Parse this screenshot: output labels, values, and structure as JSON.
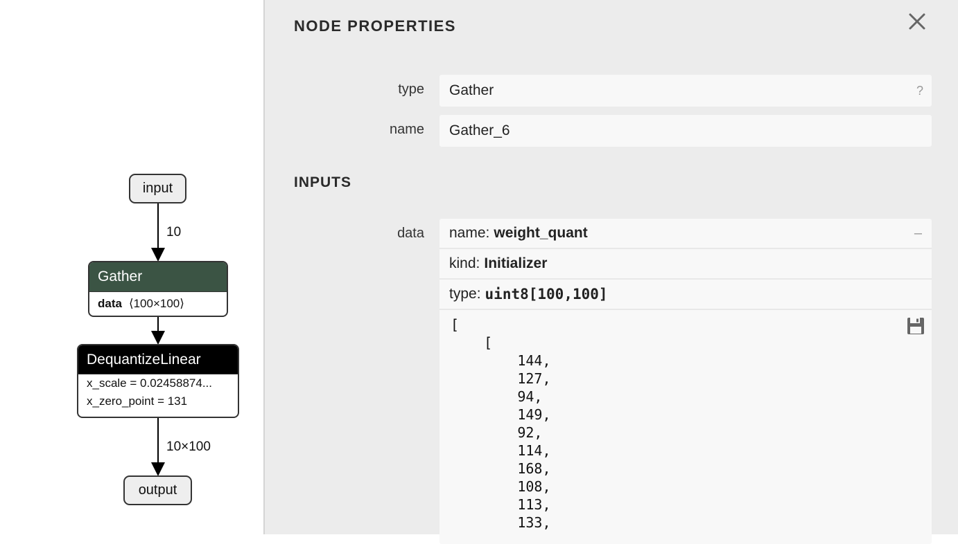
{
  "graph": {
    "input_label": "input",
    "output_label": "output",
    "edge_input_to_gather": "10",
    "edge_dq_to_output": "10×100",
    "gather": {
      "title": "Gather",
      "attr_name": "data",
      "attr_value": "⟨100×100⟩",
      "header_color": "#3b5444"
    },
    "dequantize": {
      "title": "DequantizeLinear",
      "scale_row": "x_scale = 0.02458874...",
      "zero_point_row": "x_zero_point = 131",
      "header_color": "#000000"
    }
  },
  "panel": {
    "title": "NODE PROPERTIES",
    "close_icon": "close-icon",
    "properties": {
      "type_label": "type",
      "type_value": "Gather",
      "type_help": "?",
      "name_label": "name",
      "name_value": "Gather_6"
    },
    "inputs": {
      "title": "INPUTS",
      "data_label": "data",
      "name_key": "name:",
      "name_value": "weight_quant",
      "collapse": "–",
      "kind_key": "kind:",
      "kind_value": "Initializer",
      "type_key": "type:",
      "type_value": "uint8[100,100]",
      "tensor_text": "[\n    [\n        144,\n        127,\n        94,\n        149,\n        92,\n        114,\n        168,\n        108,\n        113,\n        133,",
      "save_icon": "save-icon"
    }
  }
}
